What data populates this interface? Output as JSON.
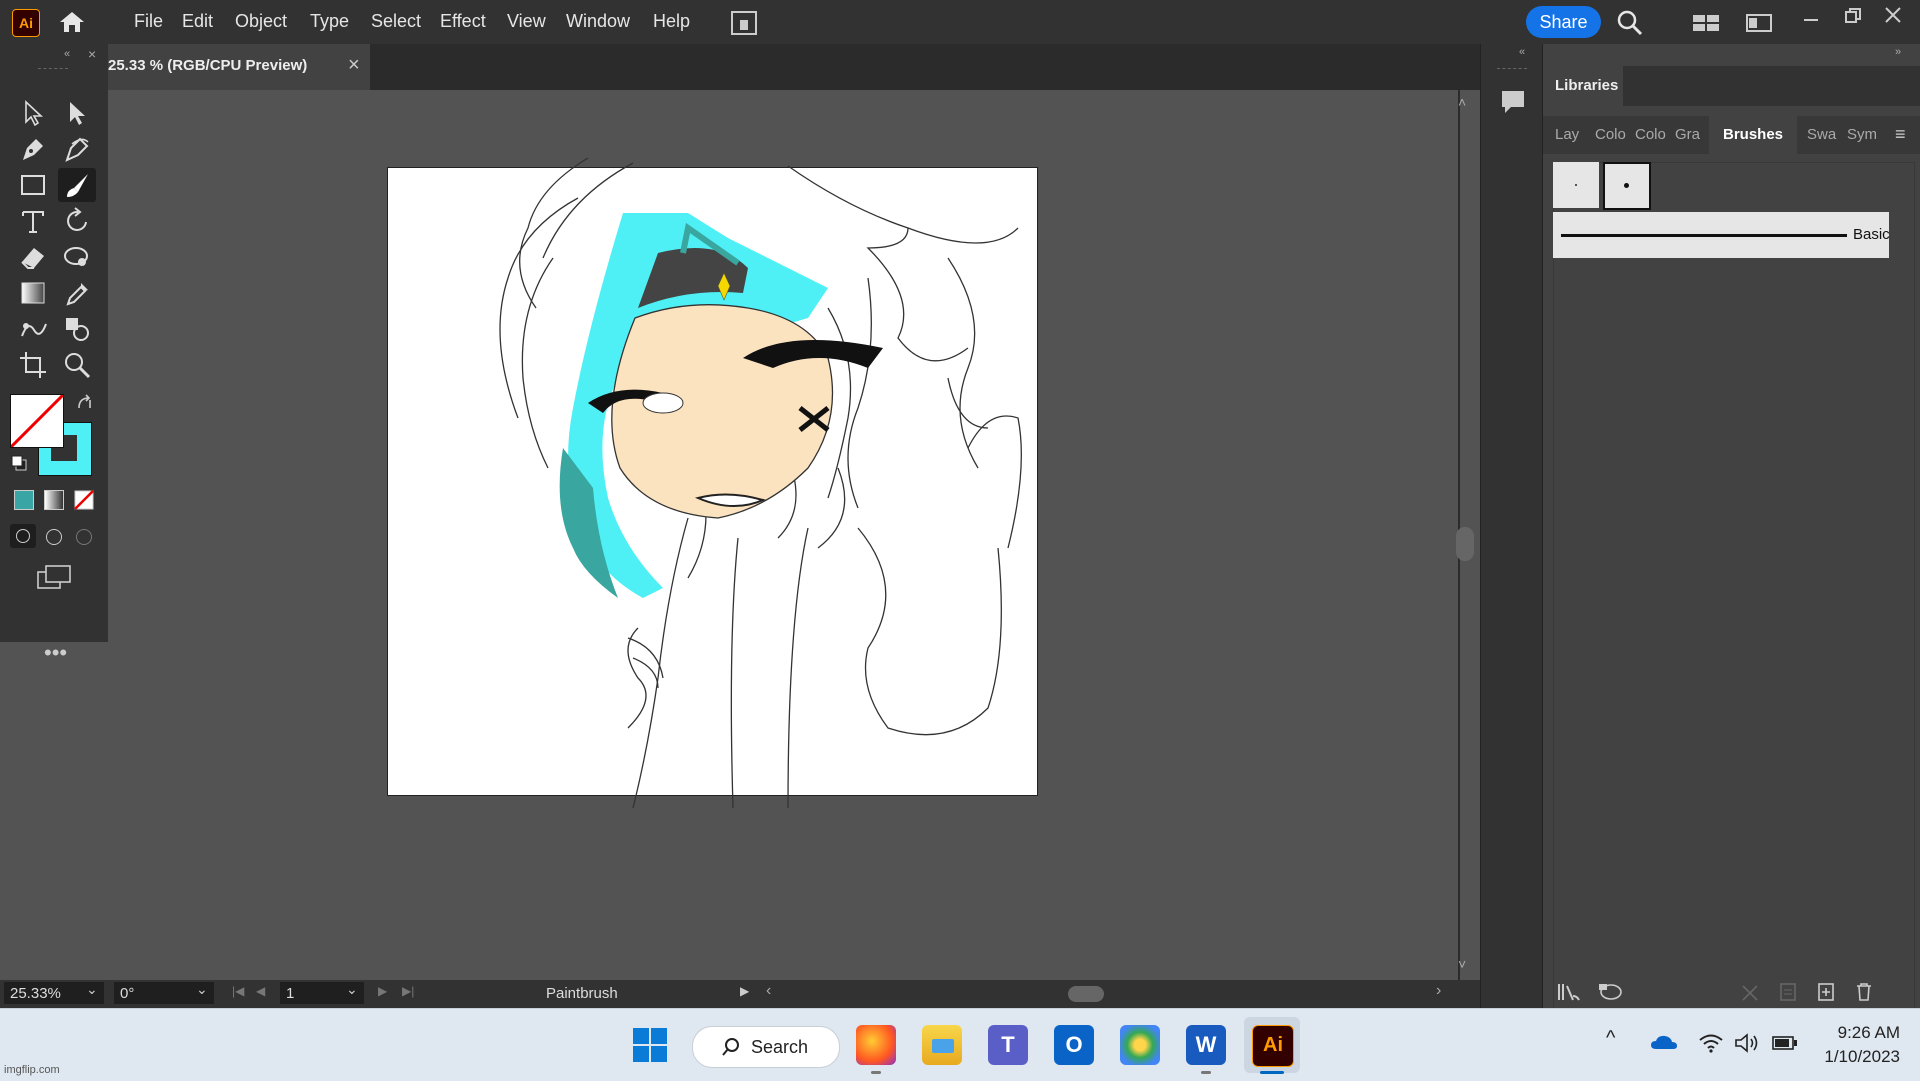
{
  "app": {
    "logo": "Ai",
    "share_label": "Share"
  },
  "menus": [
    "File",
    "Edit",
    "Object",
    "Type",
    "Select",
    "Effect",
    "View",
    "Window",
    "Help"
  ],
  "document": {
    "tab_title": "25.33 % (RGB/CPU Preview)",
    "close": "×"
  },
  "status": {
    "zoom": "25.33%",
    "rotation": "0°",
    "artboard": "1",
    "current_tool": "Paintbrush"
  },
  "panel": {
    "title": "Libraries",
    "tabs": [
      "Lay",
      "Colo",
      "Colo",
      "Gra",
      "Brushes",
      "Swa",
      "Sym"
    ],
    "active_tab": "Brushes",
    "brush_label": "Basic"
  },
  "taskbar": {
    "search_label": "Search",
    "time": "9:26 AM",
    "date": "1/10/2023"
  },
  "watermark": "imgflip.com",
  "colors": {
    "fill": "#ffffff",
    "stroke": "#4ff0f5",
    "accent": "#1473e6",
    "hair_cyan": "#4ff0f5",
    "skin": "#fbe3c0"
  }
}
